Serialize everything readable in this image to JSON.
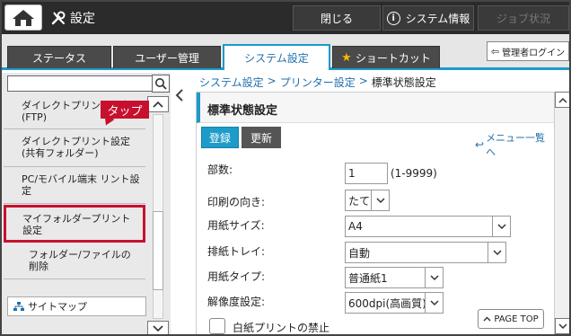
{
  "topbar": {
    "title": "設定",
    "close_label": "閉じる",
    "sysinfo_label": "システム情報",
    "job_label": "ジョブ状況",
    "home_icon": "home-icon",
    "settings_icon": "wrench-screwdriver-icon"
  },
  "tabs": [
    {
      "label": "ステータス",
      "active": false
    },
    {
      "label": "ユーザー管理",
      "active": false
    },
    {
      "label": "システム設定",
      "active": true
    },
    {
      "label": "ショートカット",
      "active": false
    }
  ],
  "admin_login": "管理者ログイン",
  "search": {
    "placeholder": "",
    "value": ""
  },
  "sidebar": {
    "items": [
      {
        "label": "ダイレクトプリント設定 (FTP)"
      },
      {
        "label": "ダイレクトプリント設定 (共有フォルダー)"
      },
      {
        "label": "PC/モバイル端末 リント設定"
      },
      {
        "label": "マイフォルダープリント設定"
      },
      {
        "label": "フォルダー/ファイルの削除"
      }
    ],
    "sitemap_label": "サイトマップ"
  },
  "callout": "タップ",
  "breadcrumb": {
    "items": [
      "システム設定",
      "プリンター設定"
    ],
    "separator": ">",
    "current": "標準状態設定"
  },
  "content": {
    "title": "標準状態設定",
    "register_label": "登録",
    "update_label": "更新",
    "menu_link": "メニュー一覧へ",
    "fields": {
      "copies_label": "部数:",
      "copies_value": "1",
      "copies_range": "(1-9999)",
      "orientation_label": "印刷の向き:",
      "orientation_value": "たて",
      "paper_size_label": "用紙サイズ:",
      "paper_size_value": "A4",
      "output_tray_label": "排紙トレイ:",
      "output_tray_value": "自動",
      "paper_type_label": "用紙タイプ:",
      "paper_type_value": "普通紙1",
      "resolution_label": "解像度設定:",
      "resolution_value": "600dpi(高画質)"
    },
    "blank_print_label": "白紙プリントの禁止",
    "pagetop_label": "PAGE TOP"
  },
  "colors": {
    "accent": "#1d9bc9",
    "highlight": "#c8102e",
    "topbar": "#2b2b2b"
  }
}
